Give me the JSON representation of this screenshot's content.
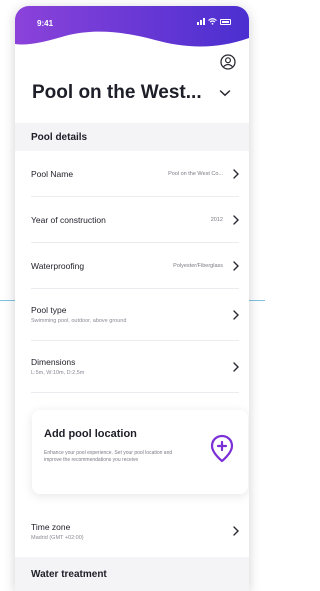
{
  "status": {
    "time": "9:41"
  },
  "header": {
    "title": "Pool on the West..."
  },
  "sections": {
    "details": "Pool details",
    "water": "Water treatment"
  },
  "rows": {
    "pool_name": {
      "label": "Pool Name",
      "value": "Pool on the West Co..."
    },
    "year": {
      "label": "Year of construction",
      "value": "2012"
    },
    "waterproofing": {
      "label": "Waterproofing",
      "value": "Polyester/Fiberglass"
    },
    "pool_type": {
      "label": "Pool type",
      "sub": "Swimming pool, outdoor, above ground"
    },
    "dimensions": {
      "label": "Dimensions",
      "sub": "L:5m, W:10m, D:2,5m"
    },
    "time_zone": {
      "label": "Time zone",
      "sub": "Madrid (GMT +02:00)"
    }
  },
  "location_card": {
    "title": "Add pool location",
    "description": "Enhance your pool experience. Set your pool location and improve the recommendations you receive"
  },
  "colors": {
    "accent": "#7b2fd6",
    "header_gradient_start": "#8a3fd9",
    "header_gradient_end": "#5a2ad1"
  }
}
